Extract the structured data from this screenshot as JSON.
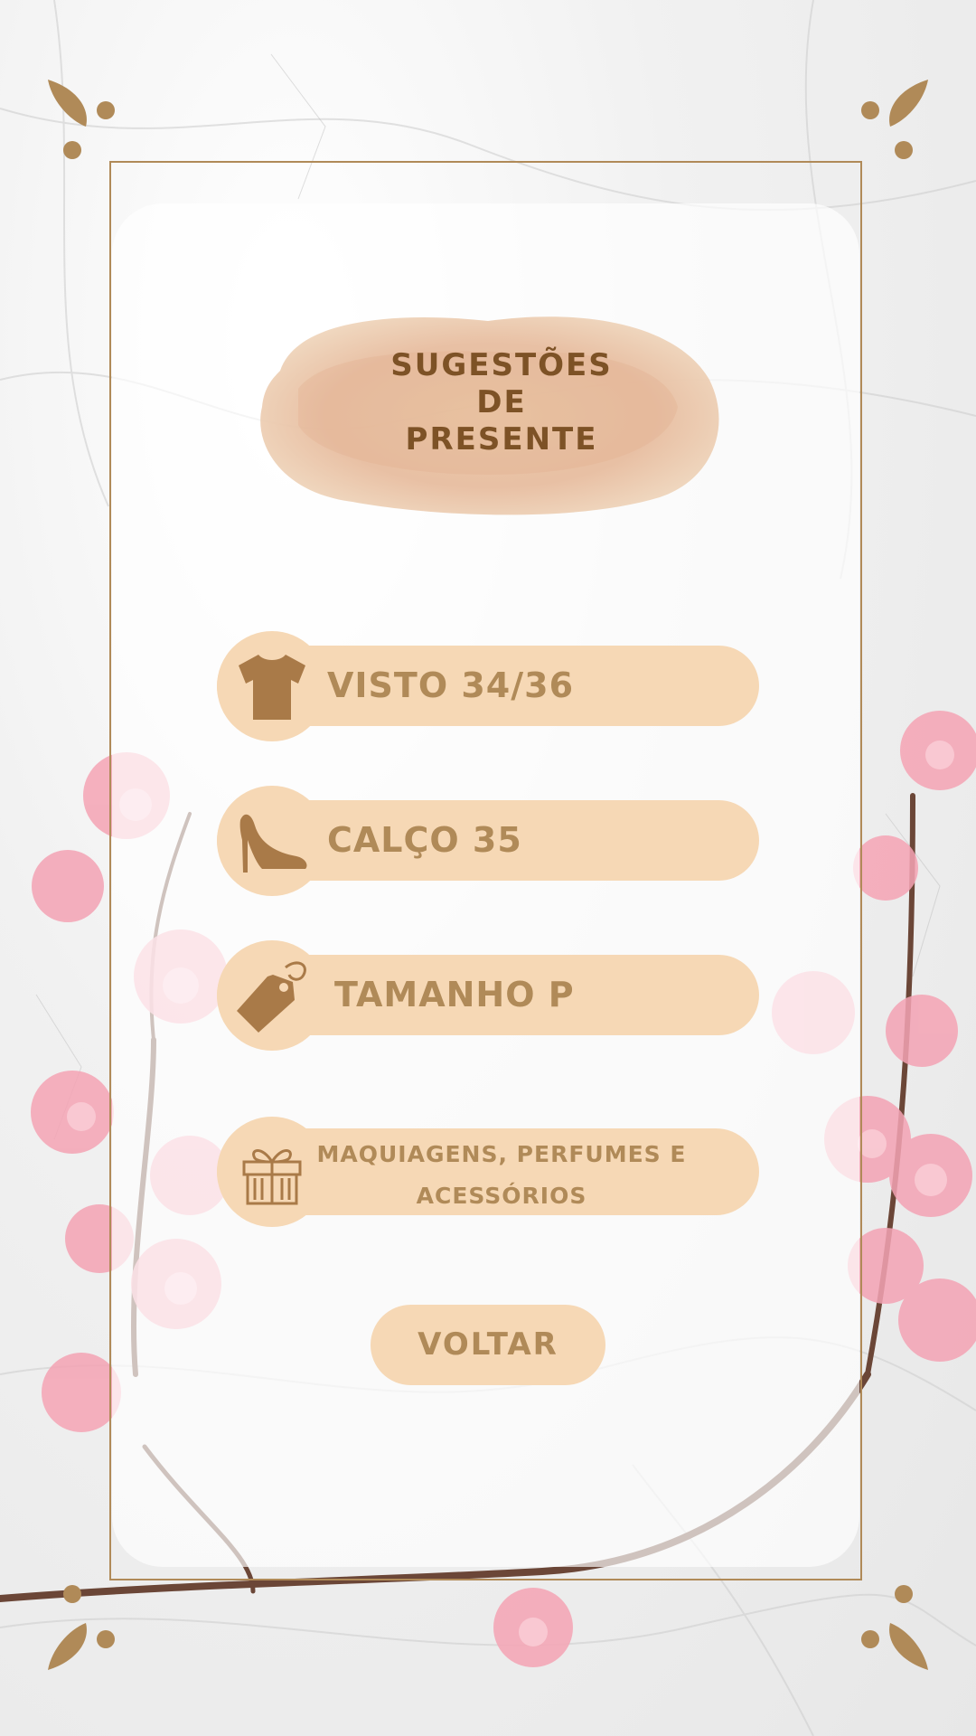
{
  "title": {
    "line1": "SUGESTÕES",
    "line2": "DE",
    "line3": "PRESENTE"
  },
  "items": [
    {
      "label": "VISTO 34/36",
      "icon": "tshirt-icon"
    },
    {
      "label": "CALÇO 35",
      "icon": "high-heel-icon"
    },
    {
      "label": "TAMANHO P",
      "icon": "price-tag-icon"
    },
    {
      "label_line1": "MAQUIAGENS, PERFUMES E",
      "label_line2": "ACESSÓRIOS",
      "icon": "gift-box-icon"
    }
  ],
  "back_button": {
    "label": "VOLTAR"
  },
  "colors": {
    "pill": "#f6d8b5",
    "text_light": "#b08a58",
    "text_dark": "#7d5226",
    "frame": "#b08a58",
    "blossom": "#f4a3b4"
  }
}
